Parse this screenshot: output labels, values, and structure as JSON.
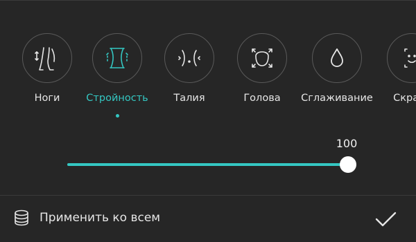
{
  "tools": [
    {
      "label": "Ноги",
      "icon": "legs-icon",
      "active": false
    },
    {
      "label": "Стройность",
      "icon": "slim-body-icon",
      "active": true
    },
    {
      "label": "Талия",
      "icon": "waist-icon",
      "active": false
    },
    {
      "label": "Голова",
      "icon": "head-icon",
      "active": false
    },
    {
      "label": "Сглаживание",
      "icon": "smooth-drop-icon",
      "active": false
    },
    {
      "label": "Скраск",
      "icon": "face-icon",
      "active": false
    }
  ],
  "slider": {
    "value": "100",
    "level": 1.0
  },
  "bottom_bar": {
    "apply_all_label": "Применить ко всем",
    "apply_all_icon": "layers-stack-icon",
    "confirm_icon": "checkmark-icon"
  },
  "colors": {
    "accent": "#34c7c2",
    "background": "#262626",
    "text": "#e6e6e6"
  }
}
